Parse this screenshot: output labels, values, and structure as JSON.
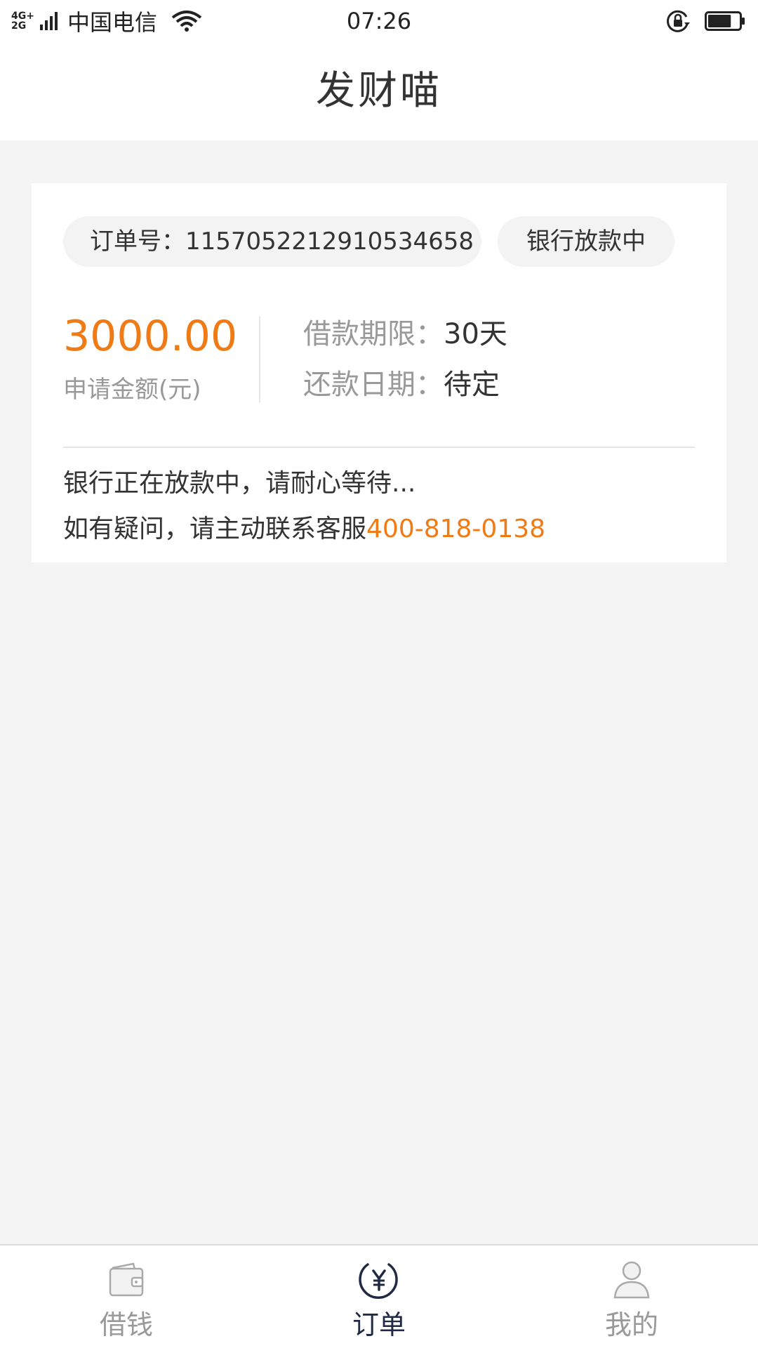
{
  "status_bar": {
    "net_type_top": "4G+",
    "net_type_bottom": "2G",
    "carrier": "中国电信",
    "time": "07:26",
    "icons": [
      "signal-icon",
      "wifi-icon",
      "rotate-lock-icon",
      "battery-icon"
    ],
    "battery_level": 0.75
  },
  "header": {
    "title": "发财喵"
  },
  "order": {
    "order_no_label": "订单号：",
    "order_no": "1157052212910534658",
    "status": "银行放款中",
    "amount": "3000.00",
    "amount_label": "申请金额(元)",
    "term_label": "借款期限：",
    "term_value": "30天",
    "repay_label": "还款日期：",
    "repay_value": "待定",
    "note_line1": "银行正在放款中，请耐心等待...",
    "note_line2_prefix": "如有疑问，请主动联系客服",
    "phone": "400-818-0138"
  },
  "bottom_nav": {
    "items": [
      {
        "label": "借钱",
        "icon": "wallet-icon",
        "active": false
      },
      {
        "label": "订单",
        "icon": "yen-order-icon",
        "active": true
      },
      {
        "label": "我的",
        "icon": "user-icon",
        "active": false
      }
    ]
  },
  "colors": {
    "accent": "#f07a14",
    "nav_active": "#1f2a44",
    "nav_inactive": "#999999",
    "background": "#f4f4f4"
  }
}
